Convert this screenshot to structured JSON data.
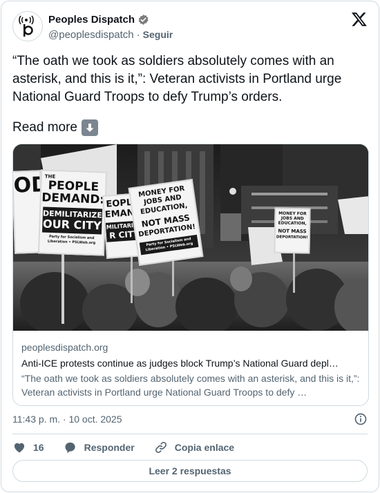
{
  "account": {
    "display_name": "Peoples Dispatch",
    "handle": "@peoplesdispatch",
    "separator": "·",
    "follow_label": "Seguir"
  },
  "tweet": {
    "text": "“The oath we took as soldiers absolutely comes with an asterisk, and this is it,”: Veteran activists in Portland urge National Guard Troops to defy Trump’s orders.",
    "read_more": "Read more",
    "read_more_emoji": "down-arrow-emoji"
  },
  "link_card": {
    "domain": "peoplesdispatch.org",
    "title": "Anti-ICE protests continue as judges block Trump’s National Guard depl…",
    "description": "“The oath we took as soldiers absolutely comes with an asterisk, and this is it,”: Veteran activists in Portland urge National Guard Troops to defy …",
    "photo_signs": {
      "sign1_line1": "THE",
      "sign1_line2": "PEOPLE",
      "sign1_line3": "DEMAND:",
      "sign1_line4": "DEMILITARIZE",
      "sign1_line5": "OUR CITY",
      "sign1_footer": "Party for Socialism and Liberation • PSLWeb.org",
      "sign2_line1": "EOPLE",
      "sign2_line2": "EMAND:",
      "sign2_line3": "MILITARIZE",
      "sign2_line4": "R CITY",
      "sign3_line1": "MONEY FOR",
      "sign3_line2": "JOBS AND",
      "sign3_line3": "EDUCATION,",
      "sign3_line4": "NOT MASS",
      "sign3_line5": "DEPORTATION!",
      "sign3_footer": "Party for Socialism and Liberation • PSLWeb.org",
      "sign4_line1": "MONEY FOR",
      "sign4_line2": "JOBS AND",
      "sign4_line3": "EDUCATION,",
      "sign4_line4": "NOT MASS",
      "sign4_line5": "DEPORTATION!",
      "sign0_text": "ODAI"
    }
  },
  "meta": {
    "timestamp": "11:43 p. m. · 10 oct. 2025"
  },
  "actions": {
    "like_count": "16",
    "reply_label": "Responder",
    "copy_link_label": "Copia enlace"
  },
  "read_replies_label": "Leer 2 respuestas"
}
